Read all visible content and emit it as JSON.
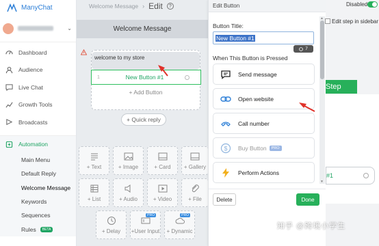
{
  "app": {
    "name": "ManyChat"
  },
  "sidebar": {
    "nav": [
      {
        "label": "Dashboard",
        "icon": "dashboard-icon"
      },
      {
        "label": "Audience",
        "icon": "user-icon"
      },
      {
        "label": "Live Chat",
        "icon": "chat-icon"
      },
      {
        "label": "Growth Tools",
        "icon": "growth-icon"
      },
      {
        "label": "Broadcasts",
        "icon": "broadcast-icon"
      }
    ],
    "automation": {
      "label": "Automation",
      "items": [
        {
          "label": "Main Menu"
        },
        {
          "label": "Default Reply"
        },
        {
          "label": "Welcome Message"
        },
        {
          "label": "Keywords"
        },
        {
          "label": "Sequences"
        },
        {
          "label": "Rules",
          "badge": "BETA"
        }
      ]
    }
  },
  "topbar": {
    "crumb": "Welcome Message",
    "edit": "Edit",
    "help": "?"
  },
  "editor": {
    "header": "Welcome Message",
    "message_text": "welcome to my store",
    "button_index": "1",
    "button_label": "New Button #1",
    "add_button": "+ Add Button",
    "quick_reply": "+ Quick reply",
    "tiles": [
      {
        "label": "+ Text"
      },
      {
        "label": "+ Image"
      },
      {
        "label": "+ Card"
      },
      {
        "label": "+ Gallery"
      },
      {
        "label": "+ List"
      },
      {
        "label": "+ Audio"
      },
      {
        "label": "+ Video"
      },
      {
        "label": "+ File"
      },
      {
        "label": "+ Delay"
      },
      {
        "label": "+User Input",
        "badge": "PRO"
      },
      {
        "label": "+ Dynamic",
        "badge": "PRO"
      }
    ]
  },
  "panel": {
    "title": "Edit Button",
    "field_label": "Button Title:",
    "field_value": "New Button #1",
    "counter": "7",
    "section": "When This Button is Pressed",
    "options": [
      {
        "label": "Send message",
        "icon": "message-icon"
      },
      {
        "label": "Open website",
        "icon": "link-icon"
      },
      {
        "label": "Call number",
        "icon": "phone-icon"
      },
      {
        "label": "Buy Button",
        "icon": "dollar-icon",
        "badge": "PRO"
      },
      {
        "label": "Perform Actions",
        "icon": "lightning-icon"
      }
    ],
    "delete": "Delete",
    "done": "Done"
  },
  "right": {
    "toggle_label": "Disabled",
    "edit_step": "Edit step in sidebar",
    "step_tab": "Step",
    "step_button": "#1"
  },
  "watermark": "知乎 @跨境小学生",
  "colors": {
    "accent": "#27b05a",
    "link": "#2d7fd7",
    "annotation": "#e0322a"
  }
}
